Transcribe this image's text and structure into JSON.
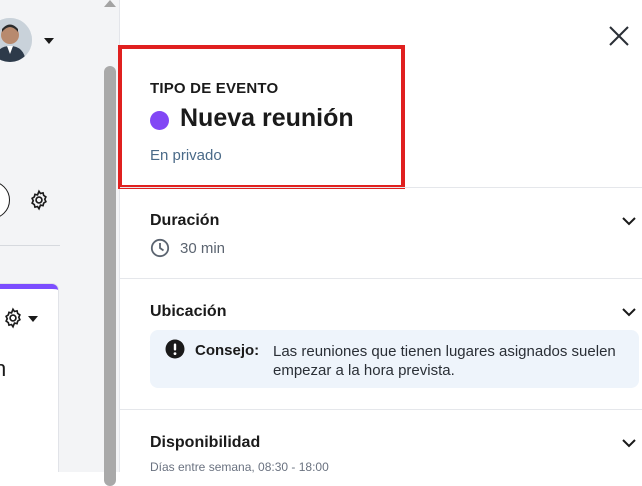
{
  "panel": {
    "event_type_label": "TIPO DE EVENTO",
    "event_name": "Nueva reunión",
    "event_color": "#8247f5",
    "event_privacy": "En privado",
    "close_icon": "close-icon"
  },
  "sections": {
    "duration": {
      "title": "Duración",
      "value": "30 min"
    },
    "location": {
      "title": "Ubicación",
      "tip_label": "Consejo:",
      "tip_text": "Las reuniones que tienen lugares asignados suelen empezar a la hora prevista."
    },
    "availability": {
      "title": "Disponibilidad",
      "subtitle": "Días entre semana, 08:30 - 18:00"
    }
  },
  "left_app": {
    "card_letter": "n"
  },
  "colors": {
    "highlight_border": "#e0201f",
    "accent": "#7b4dff",
    "tip_background": "#eef4fb"
  }
}
